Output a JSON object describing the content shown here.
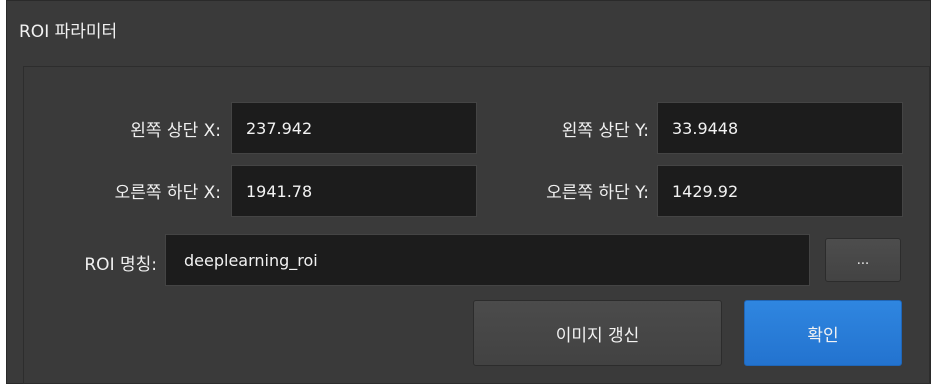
{
  "panel": {
    "title": "ROI 파라미터"
  },
  "fields": {
    "top_left_x": {
      "label": "왼쪽 상단 X:",
      "value": "237.942"
    },
    "top_left_y": {
      "label": "왼쪽 상단 Y:",
      "value": "33.9448"
    },
    "bottom_right_x": {
      "label": "오른쪽 하단 X:",
      "value": "1941.78"
    },
    "bottom_right_y": {
      "label": "오른쪽 하단 Y:",
      "value": "1429.92"
    },
    "roi_name": {
      "label": "ROI 명칭:",
      "value": "deeplearning_roi"
    }
  },
  "buttons": {
    "browse": "...",
    "update_image": "이미지 갱신",
    "confirm": "확인"
  },
  "colors": {
    "background": "#3a3a3a",
    "field_background": "#1c1c1c",
    "primary": "#2a7fdc"
  }
}
